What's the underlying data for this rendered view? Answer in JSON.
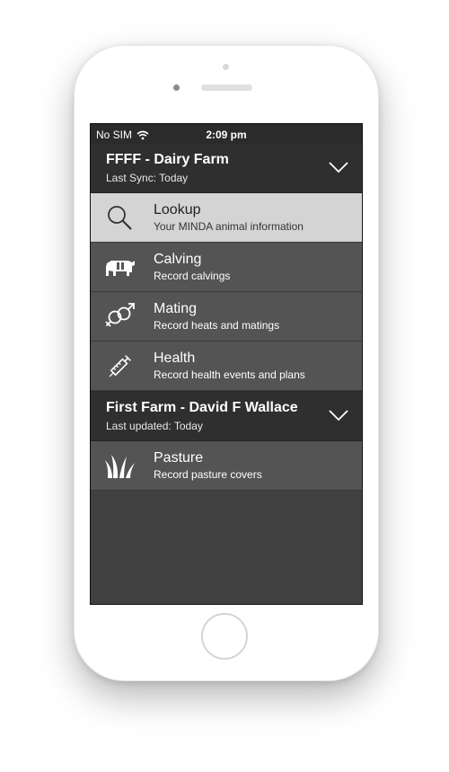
{
  "status_bar": {
    "carrier": "No SIM",
    "time": "2:09 pm",
    "wifi_icon": "wifi-icon"
  },
  "groups": [
    {
      "title": "FFFF - Dairy Farm",
      "subtitle": "Last Sync: Today",
      "expand_icon": "chevron-down-icon",
      "items": [
        {
          "label": "Lookup",
          "subtitle": "Your MINDA animal information",
          "icon": "search-icon",
          "selected": true
        },
        {
          "label": "Calving",
          "subtitle": "Record calvings",
          "icon": "cow-icon",
          "selected": false
        },
        {
          "label": "Mating",
          "subtitle": "Record heats and matings",
          "icon": "gender-symbols-icon",
          "selected": false
        },
        {
          "label": "Health",
          "subtitle": "Record health events and plans",
          "icon": "syringe-icon",
          "selected": false
        }
      ]
    },
    {
      "title": "First Farm - David F Wallace",
      "subtitle": "Last updated: Today",
      "expand_icon": "chevron-down-icon",
      "items": [
        {
          "label": "Pasture",
          "subtitle": "Record pasture covers",
          "icon": "grass-icon",
          "selected": false
        }
      ]
    }
  ],
  "colors": {
    "header_bg": "#2f2f2f",
    "item_bg": "#545454",
    "selected_bg": "#d4d4d4",
    "screen_bg": "#414141"
  }
}
